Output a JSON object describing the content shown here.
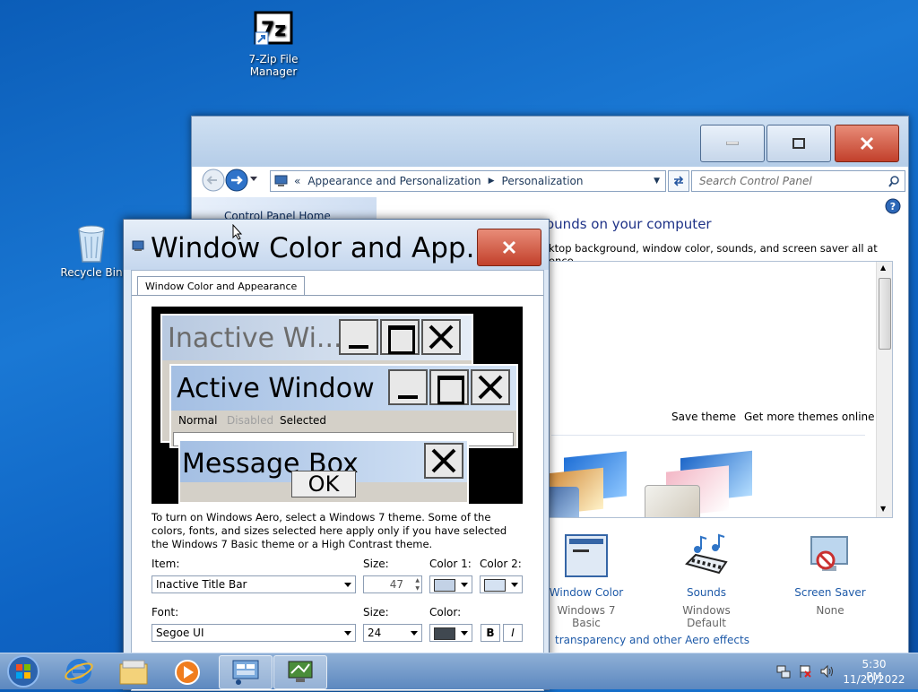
{
  "desktop": {
    "icons": [
      {
        "label": "7-Zip File Manager",
        "icon": "7zip-icon"
      },
      {
        "label": "Recycle Bin",
        "icon": "recycle-bin-icon"
      }
    ]
  },
  "control_panel": {
    "breadcrumb": {
      "overflow": "«",
      "item1": "Appearance and Personalization",
      "item2": "Personalization"
    },
    "search_placeholder": "Search Control Panel",
    "left_link": "Control Panel Home",
    "heading": "Change the visuals and sounds on your computer",
    "heading_visible": "ounds on your computer",
    "subheading": "ktop background, window color, sounds, and screen saver all at once.",
    "save_theme": "Save theme",
    "get_more_themes": "Get more themes online",
    "bottom_items": [
      {
        "title": "Window Color",
        "sub": "Windows 7 Basic",
        "icon": "window-color-icon"
      },
      {
        "title": "Sounds",
        "sub": "Windows Default",
        "icon": "sounds-icon"
      },
      {
        "title": "Screen Saver",
        "sub": "None",
        "icon": "screen-saver-icon"
      }
    ],
    "aero_link": "transparency and other Aero effects"
  },
  "dialog": {
    "title": "Window Color and App...",
    "tab": "Window Color and Appearance",
    "preview": {
      "inactive": "Inactive Wi...",
      "active": "Active Window",
      "menu": [
        "Normal",
        "Disabled",
        "Selected"
      ],
      "message": "Message Box",
      "ok": "OK"
    },
    "info": "To turn on Windows Aero, select a Windows 7 theme.  Some of the colors, fonts, and sizes selected here apply only if you have selected the Windows 7 Basic theme or a High Contrast theme.",
    "item_label": "Item:",
    "item_value": "Inactive Title Bar",
    "size_label": "Size:",
    "size_value": "47",
    "color1_label": "Color 1:",
    "color2_label": "Color 2:",
    "font_label": "Font:",
    "font_value": "Segoe UI",
    "font_size_label": "Size:",
    "font_size_value": "24",
    "font_color_label": "Color:",
    "bold": "B",
    "italic": "I",
    "colors": {
      "color1": "#c3d2e6",
      "color2": "#d5e2f2",
      "font_color": "#404850"
    }
  },
  "taskbar": {
    "time": "5:30 PM",
    "date": "11/20/2022",
    "buttons": [
      "start-orb",
      "internet-explorer",
      "windows-explorer",
      "media-player",
      "control-panel",
      "window-color"
    ]
  }
}
